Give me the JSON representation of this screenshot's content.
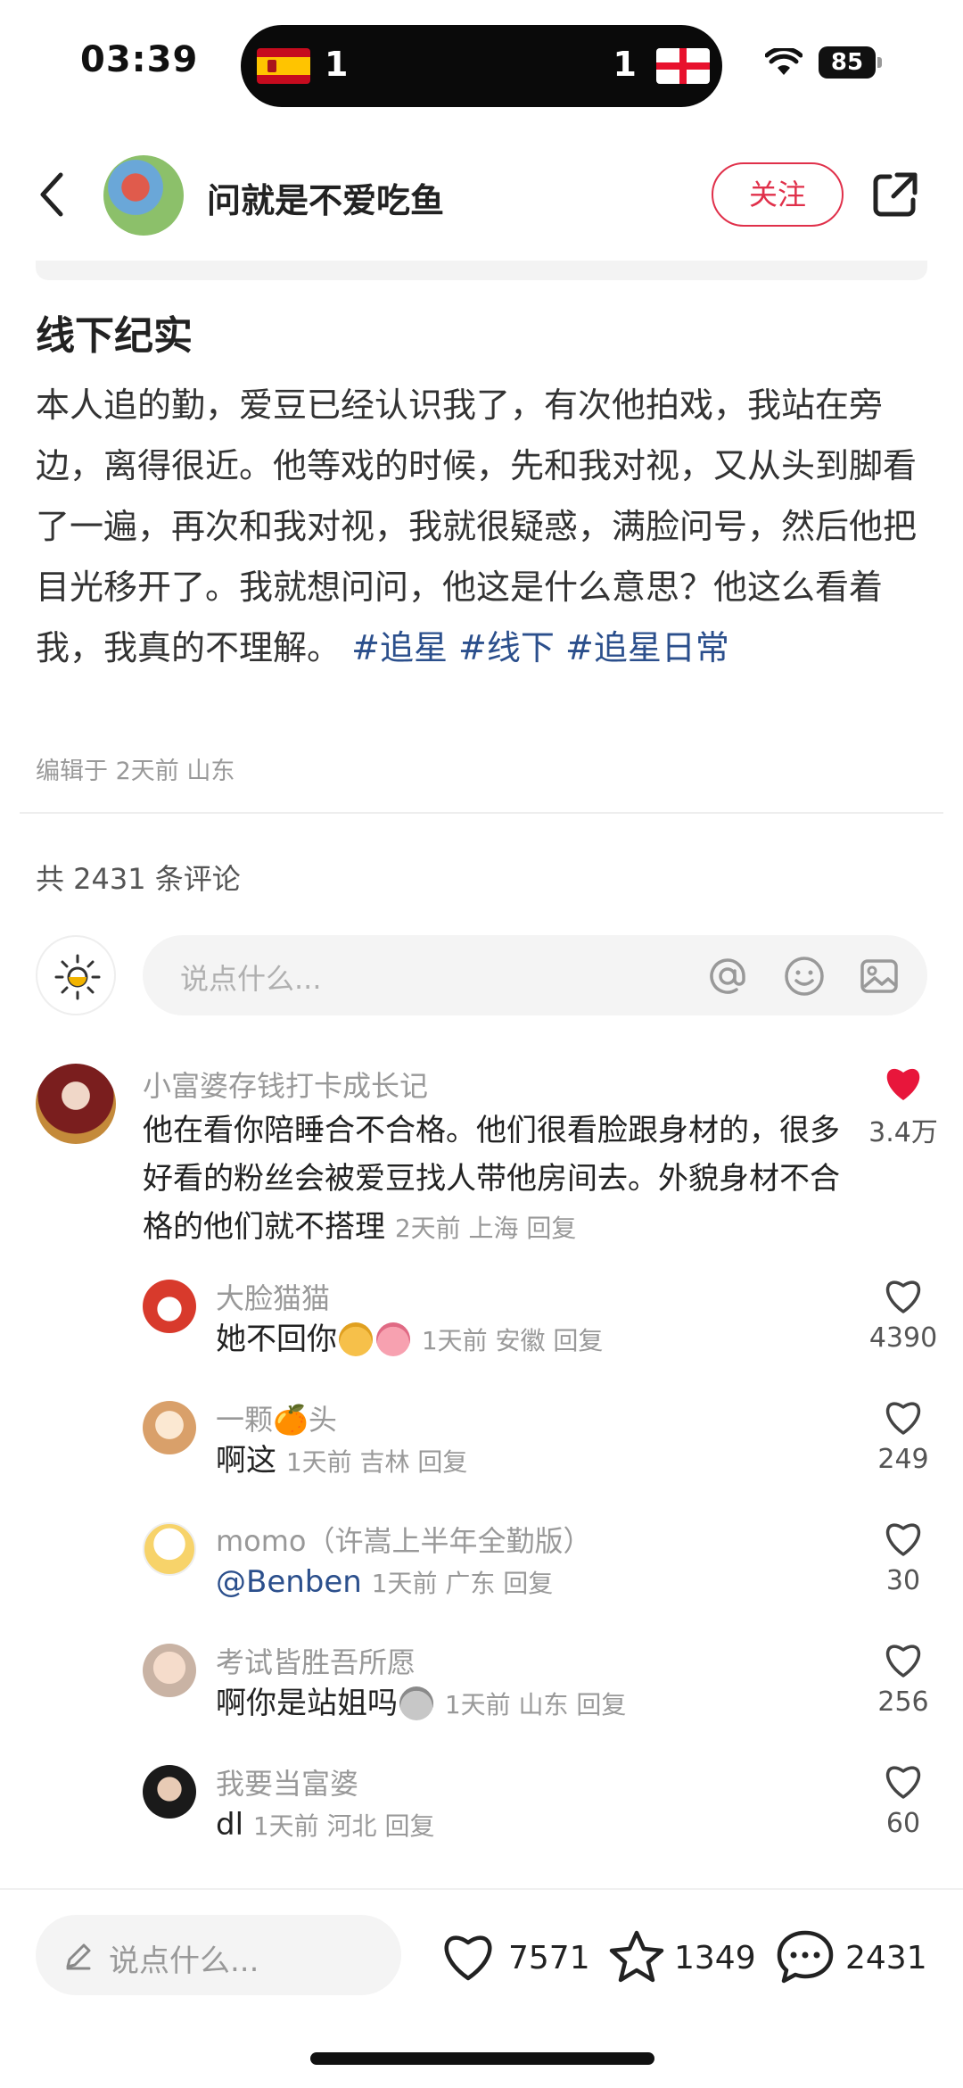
{
  "status_bar": {
    "time": "03:39",
    "score_left": "1",
    "score_right": "1",
    "battery": "85"
  },
  "header": {
    "author": "问就是不爱吃鱼",
    "follow_label": "关注"
  },
  "post": {
    "title": "线下纪实",
    "body": "本人追的勤，爱豆已经认识我了，有次他拍戏，我站在旁边，离得很近。他等戏的时候，先和我对视，又从头到脚看了一遍，再次和我对视，我就很疑惑，满脸问号，然后他把目光移开了。我就想问问，他这是什么意思？他这么看着我，我真的不理解。",
    "tags": [
      "#追星",
      "#线下",
      "#追星日常"
    ],
    "meta": "编辑于 2天前 山东"
  },
  "comments_header": {
    "count_text": "共 2431 条评论",
    "input_placeholder": "说点什么..."
  },
  "comments": [
    {
      "name": "小富婆存钱打卡成长记",
      "text": "他在看你陪睡合不合格。他们很看脸跟身材的，很多好看的粉丝会被爱豆找人带他房间去。外貌身材不合格的他们就不搭理",
      "meta": "2天前 上海 回复",
      "likes": "3.4万",
      "liked": true
    },
    {
      "name": "大脸猫猫",
      "text": "她不回你",
      "meta": "1天前 安徽 回复",
      "likes": "4390"
    },
    {
      "name": "一颗🍊头",
      "text": "啊这",
      "meta": "1天前 吉林 回复",
      "likes": "249"
    },
    {
      "name": "momo（许嵩上半年全勤版）",
      "text": "@Benben",
      "meta": "1天前 广东 回复",
      "likes": "30"
    },
    {
      "name": "考试皆胜吾所愿",
      "text": "啊你是站姐吗",
      "meta": "1天前 山东 回复",
      "likes": "256"
    },
    {
      "name": "我要当富婆",
      "text": "dl",
      "meta": "1天前 河北 回复",
      "likes": "60"
    }
  ],
  "bottom_bar": {
    "input_placeholder": "说点什么...",
    "likes": "7571",
    "favorites": "1349",
    "comments": "2431"
  },
  "colors": {
    "accent": "#e0304a",
    "tag": "#2b4f8c",
    "muted": "#999999"
  }
}
